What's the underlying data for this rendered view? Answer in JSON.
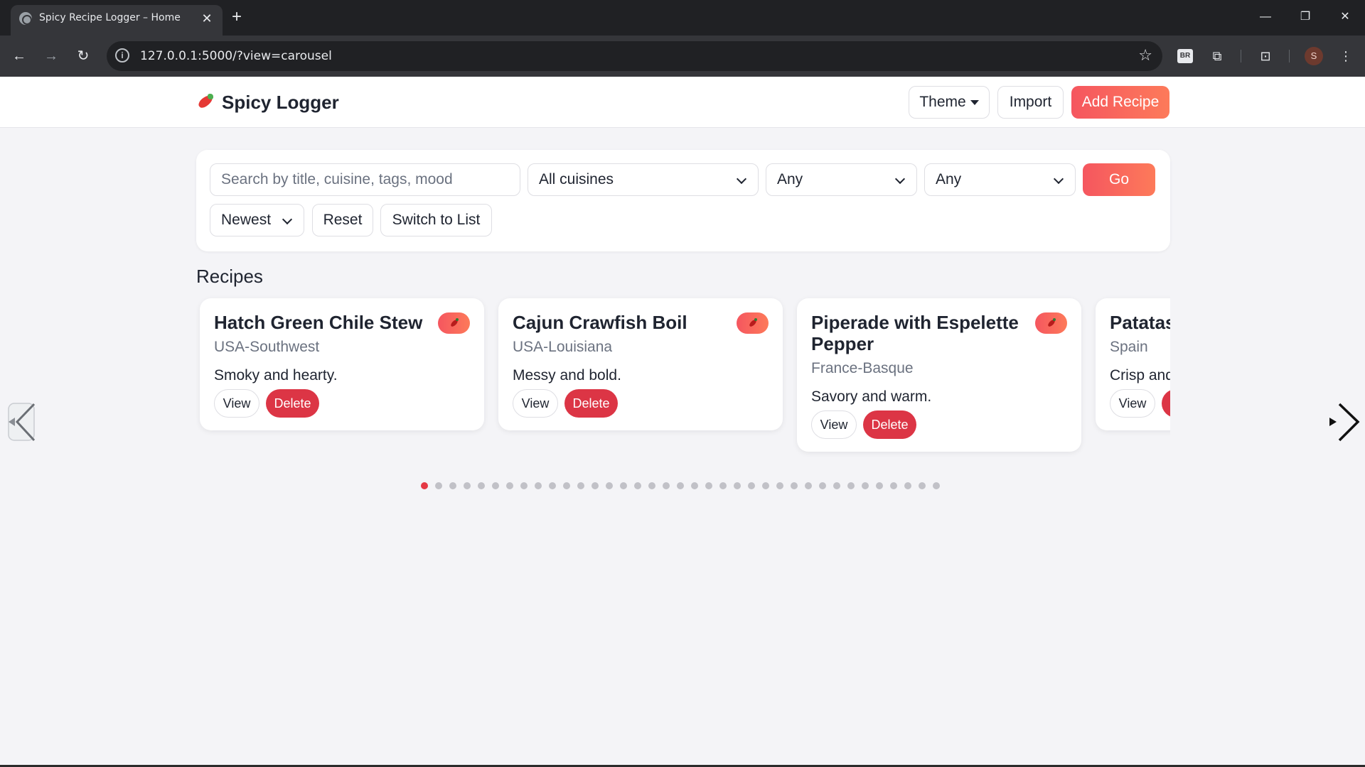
{
  "browser": {
    "tab_title": "Spicy Recipe Logger – Home",
    "url": "127.0.0.1:5000/?view=carousel",
    "extension_badge": "BR",
    "profile_initial": "S"
  },
  "header": {
    "brand": "Spicy Logger",
    "theme_label": "Theme",
    "import_label": "Import",
    "add_label": "Add Recipe"
  },
  "filters": {
    "search_placeholder": "Search by title, cuisine, tags, mood",
    "cuisine_value": "All cuisines",
    "select2_value": "Any",
    "select3_value": "Any",
    "go_label": "Go",
    "sort_value": "Newest",
    "reset_label": "Reset",
    "switch_label": "Switch to List"
  },
  "recipes": {
    "section_title": "Recipes",
    "view_label": "View",
    "delete_label": "Delete",
    "cards": [
      {
        "title": "Hatch Green Chile Stew",
        "cuisine": "USA-Southwest",
        "desc": "Smoky and hearty."
      },
      {
        "title": "Cajun Crawfish Boil",
        "cuisine": "USA-Louisiana",
        "desc": "Messy and bold."
      },
      {
        "title": "Piperade with Espelette Pepper",
        "cuisine": "France-Basque",
        "desc": "Savory and warm."
      },
      {
        "title": "Patatas Bravas",
        "cuisine": "Spain",
        "desc": "Crisp and spicy."
      }
    ]
  },
  "pagination": {
    "total_pages": 37,
    "current_page": 1
  },
  "colors": {
    "accent_gradient_start": "#f5565f",
    "accent_gradient_end": "#fd7a5a",
    "danger": "#dc3545",
    "active_dot": "#e53945"
  }
}
